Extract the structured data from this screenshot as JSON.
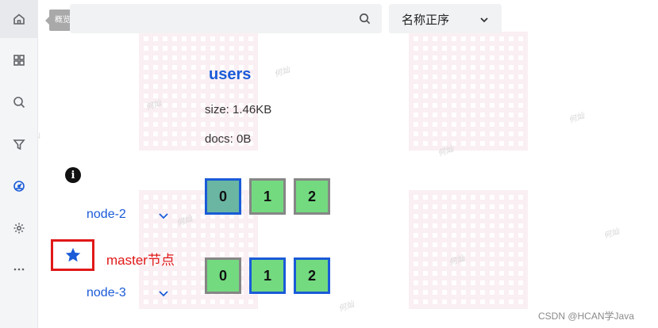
{
  "sidebar": {
    "tooltip": "概览",
    "items": [
      {
        "name": "sidebar-item-home"
      },
      {
        "name": "sidebar-item-dashboard"
      },
      {
        "name": "sidebar-item-search"
      },
      {
        "name": "sidebar-item-filter"
      },
      {
        "name": "sidebar-item-cluster"
      },
      {
        "name": "sidebar-item-settings"
      },
      {
        "name": "sidebar-item-more"
      }
    ]
  },
  "toolbar": {
    "search_value": "",
    "sort_label": "名称正序"
  },
  "index": {
    "name": "users",
    "size": "size: 1.46KB",
    "docs": "docs: 0B"
  },
  "nodes": [
    {
      "label": "node-2",
      "shards": [
        "0",
        "1",
        "2"
      ]
    },
    {
      "label": "node-3",
      "shards": [
        "0",
        "1",
        "2"
      ]
    }
  ],
  "annotation": {
    "master_label": "master节点"
  },
  "watermark_text": "何灿",
  "footer": "CSDN @HCAN学Java",
  "colors": {
    "accent": "#1a5bd8",
    "shard_green": "#73da80",
    "annotation_red": "#e01818"
  }
}
